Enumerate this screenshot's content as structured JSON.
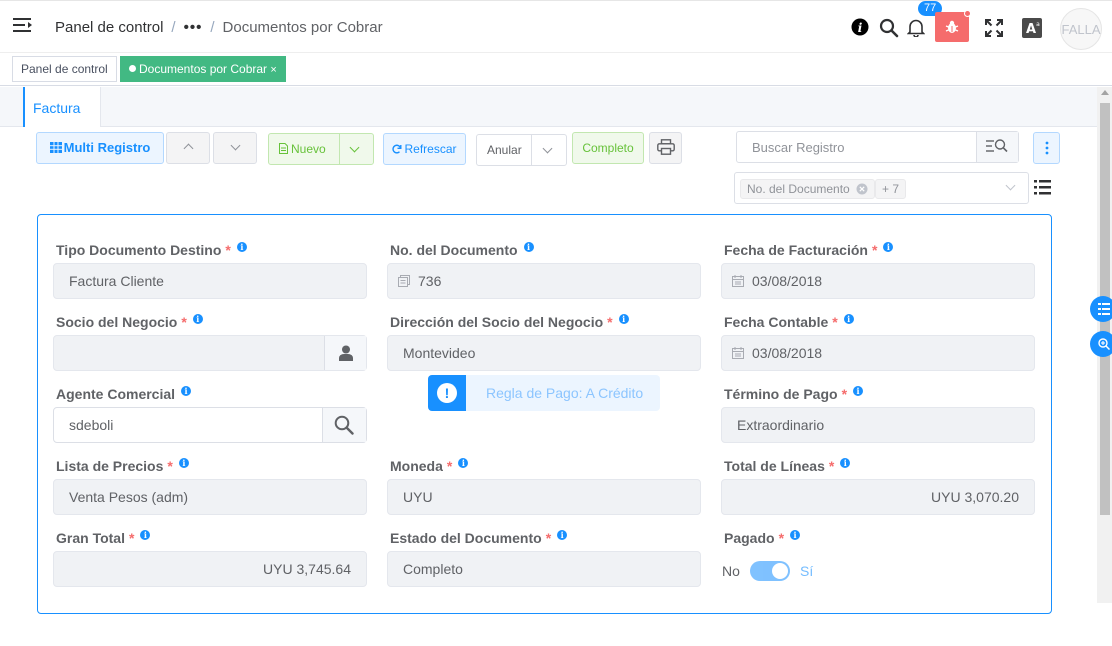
{
  "header": {
    "breadcrumb": {
      "root": "Panel de control",
      "ellipsis": "•••",
      "current": "Documentos por Cobrar"
    },
    "notifications_count": "77",
    "avatar_text": "FALLA"
  },
  "tags": {
    "dashboard": "Panel de control",
    "active": "Documentos por Cobrar",
    "close": "×"
  },
  "tabs": {
    "factura": "Factura"
  },
  "toolbar": {
    "multi_registro": "Multi Registro",
    "nuevo": "Nuevo",
    "refrescar": "Refrescar",
    "anular": "Anular",
    "completo": "Completo"
  },
  "search": {
    "placeholder": "Buscar Registro"
  },
  "column_selector": {
    "chip": "No. del Documento",
    "more": "+ 7"
  },
  "form": {
    "tipo_documento": {
      "label": "Tipo Documento Destino",
      "value": "Factura Cliente",
      "required": true
    },
    "no_documento": {
      "label": "No. del Documento",
      "value": "736",
      "required": false
    },
    "fecha_facturacion": {
      "label": "Fecha de Facturación",
      "value": "03/08/2018",
      "required": true
    },
    "socio_negocio": {
      "label": "Socio del Negocio",
      "value": "",
      "required": true
    },
    "direccion_socio": {
      "label": "Dirección del Socio del Negocio",
      "value": "Montevideo",
      "required": true
    },
    "fecha_contable": {
      "label": "Fecha Contable",
      "value": "03/08/2018",
      "required": true
    },
    "agente_comercial": {
      "label": "Agente Comercial",
      "value": "sdeboli",
      "required": false
    },
    "regla_pago": "Regla de Pago: A Crédito",
    "termino_pago": {
      "label": "Término de Pago",
      "value": "Extraordinario",
      "required": true
    },
    "lista_precios": {
      "label": "Lista de Precios",
      "value": "Venta Pesos (adm)",
      "required": true
    },
    "moneda": {
      "label": "Moneda",
      "value": "UYU",
      "required": true
    },
    "total_lineas": {
      "label": "Total de Líneas",
      "value": "UYU 3,070.20",
      "required": true
    },
    "gran_total": {
      "label": "Gran Total",
      "value": "UYU 3,745.64",
      "required": true
    },
    "estado_documento": {
      "label": "Estado del Documento",
      "value": "Completo",
      "required": true
    },
    "pagado": {
      "label": "Pagado",
      "off_label": "No",
      "on_label": "Sí",
      "value": true,
      "required": true
    }
  },
  "required_mark": "*",
  "info_mark": "i",
  "colors": {
    "primary": "#1890ff",
    "success": "#42b983",
    "danger": "#f56c6c",
    "field_bg": "#f0f2f5"
  }
}
